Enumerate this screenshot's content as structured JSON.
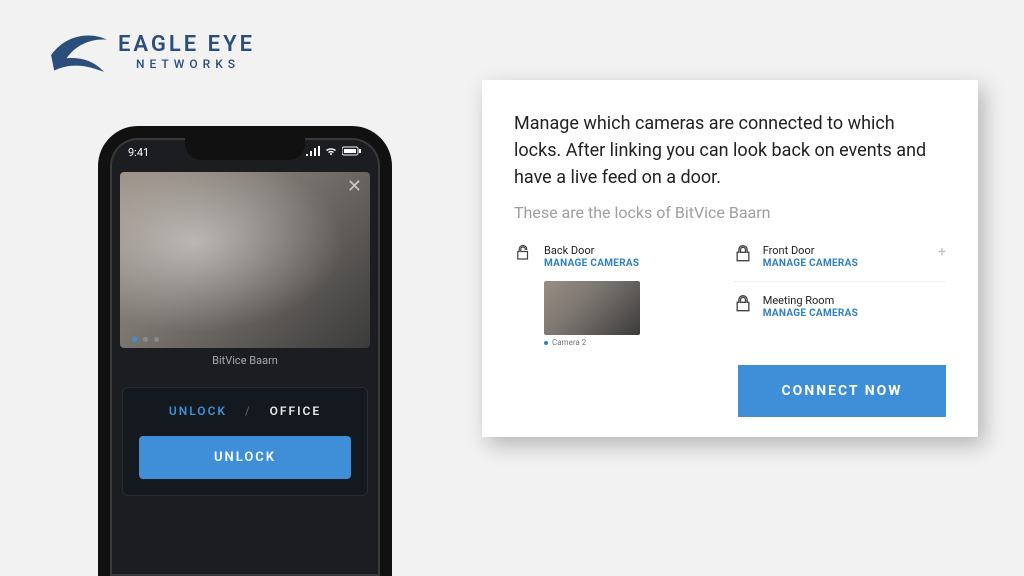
{
  "logo": {
    "line1": "EAGLE EYE",
    "line2": "NETWORKS"
  },
  "phone": {
    "time": "9:41",
    "camera_label": "BitVice Baarn",
    "tabs": {
      "unlock": "UNLOCK",
      "sep": "/",
      "office": "OFFICE"
    },
    "unlock_button": "UNLOCK"
  },
  "panel": {
    "description": "Manage which cameras are connected to which locks. After linking you can look back on events and have a live feed on a door.",
    "subtitle": "These are the locks of BitVice Baarn",
    "locks": {
      "back_door": {
        "name": "Back Door",
        "action": "MANAGE CAMERAS",
        "camera_caption": "Camera 2"
      },
      "front_door": {
        "name": "Front Door",
        "action": "MANAGE CAMERAS"
      },
      "meeting_room": {
        "name": "Meeting Room",
        "action": "MANAGE CAMERAS"
      }
    },
    "connect_button": "CONNECT NOW"
  }
}
